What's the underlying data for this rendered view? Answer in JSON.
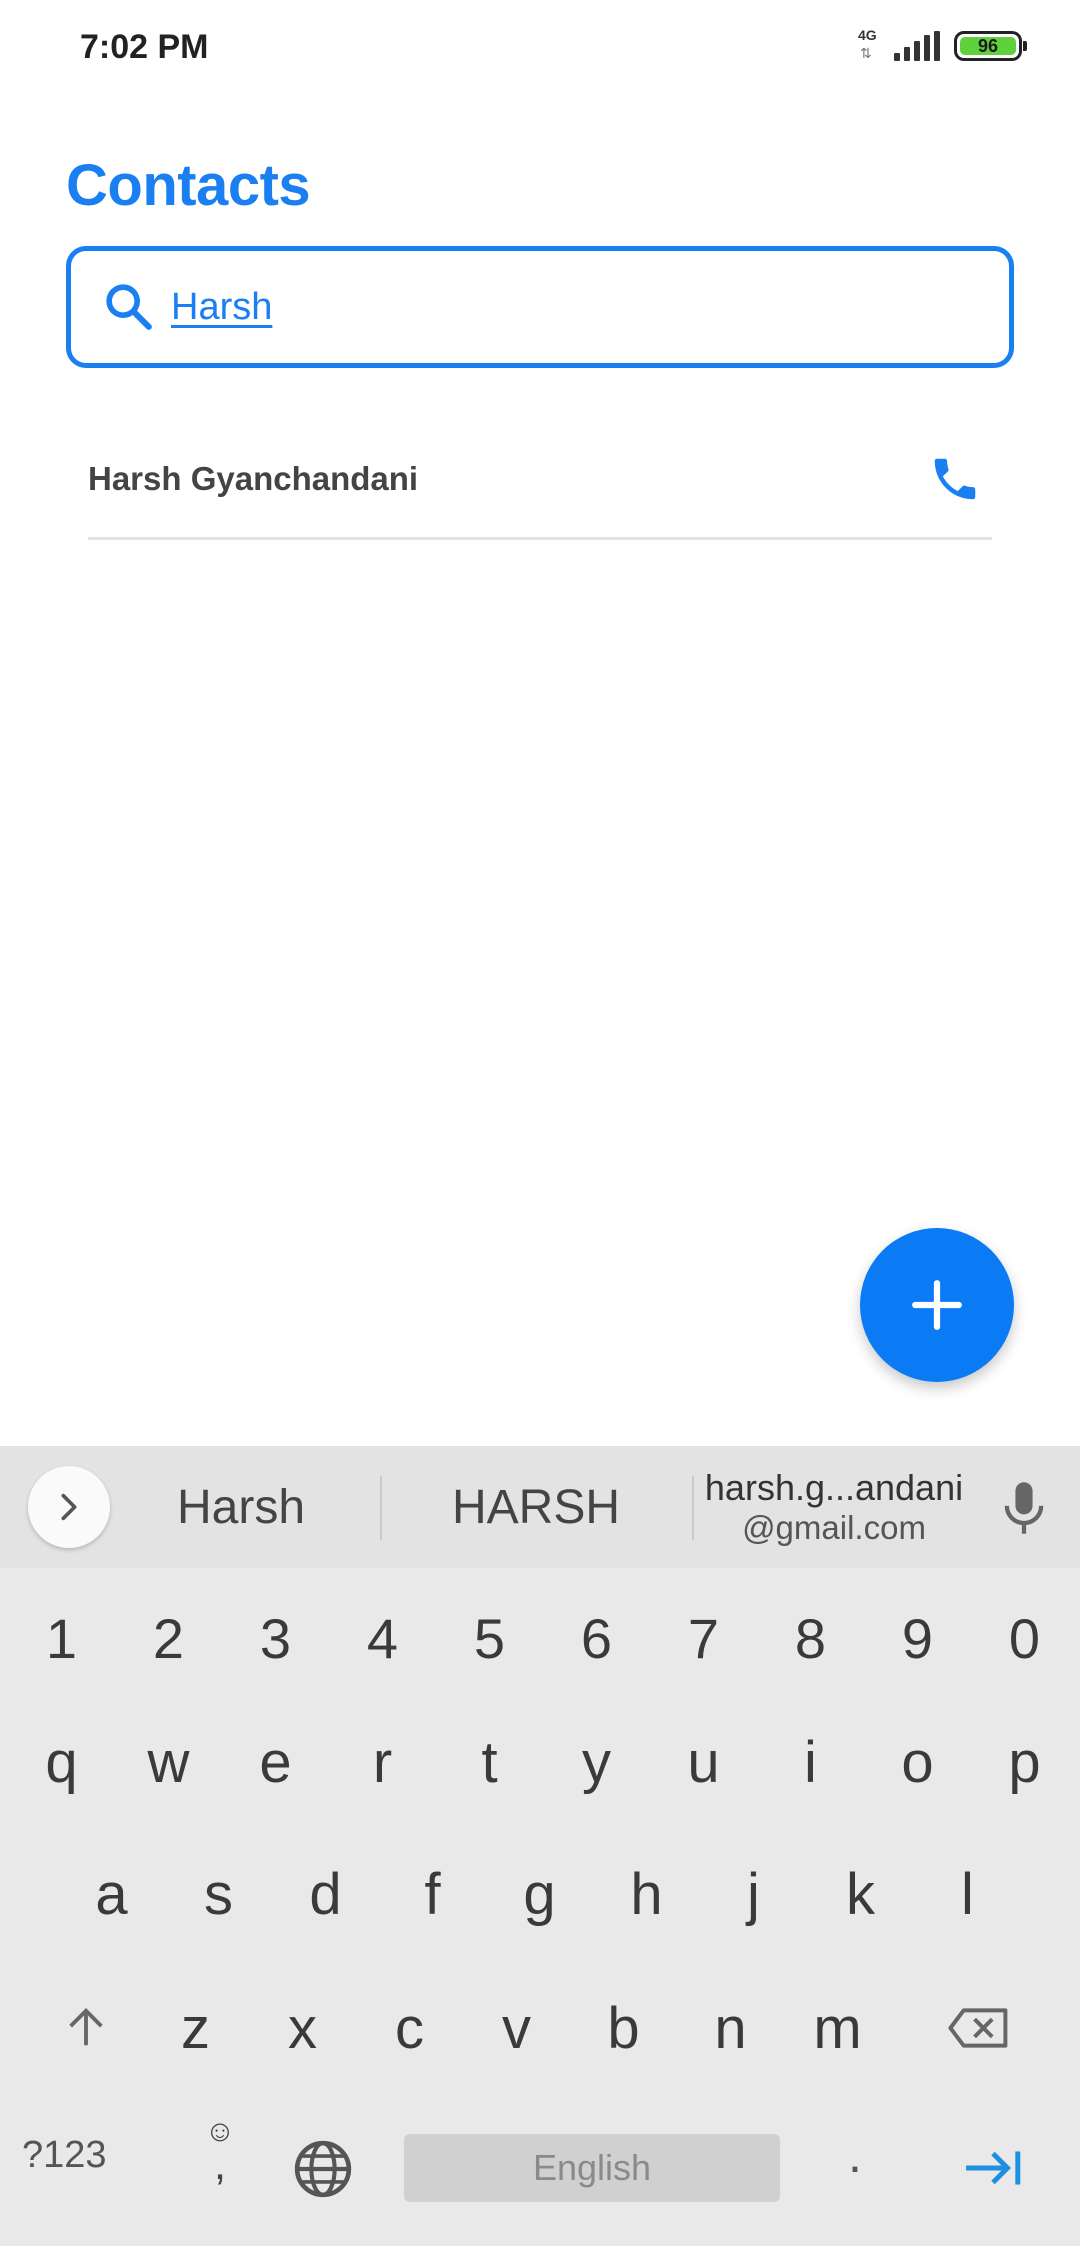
{
  "status_bar": {
    "time": "7:02 PM",
    "network_type": "4G",
    "battery_level": "96",
    "colors": {
      "battery_fill": "#5fd13b"
    }
  },
  "header": {
    "title": "Contacts"
  },
  "search": {
    "value": "Harsh",
    "icon": "search-icon"
  },
  "contacts": [
    {
      "name": "Harsh Gyanchandani",
      "action_icon": "phone-icon"
    }
  ],
  "fab": {
    "icon": "plus-icon"
  },
  "keyboard": {
    "suggestions": [
      "Harsh",
      "HARSH"
    ],
    "email_suggestion": {
      "line1": "harsh.g...andani",
      "line2": "@gmail.com"
    },
    "number_row": [
      "1",
      "2",
      "3",
      "4",
      "5",
      "6",
      "7",
      "8",
      "9",
      "0"
    ],
    "row1": [
      "q",
      "w",
      "e",
      "r",
      "t",
      "y",
      "u",
      "i",
      "o",
      "p"
    ],
    "row2": [
      "a",
      "s",
      "d",
      "f",
      "g",
      "h",
      "j",
      "k",
      "l"
    ],
    "row3": [
      "z",
      "x",
      "c",
      "v",
      "b",
      "n",
      "m"
    ],
    "symbols_label": "?123",
    "emoji_comma": {
      "emoji": "☺",
      "comma": ","
    },
    "space_label": "English",
    "period": "."
  },
  "colors": {
    "accent": "#1a7ff0",
    "fab": "#0a7af5",
    "keyboard_bg": "#e9e9e9",
    "enter_key": "#1e90e0"
  }
}
